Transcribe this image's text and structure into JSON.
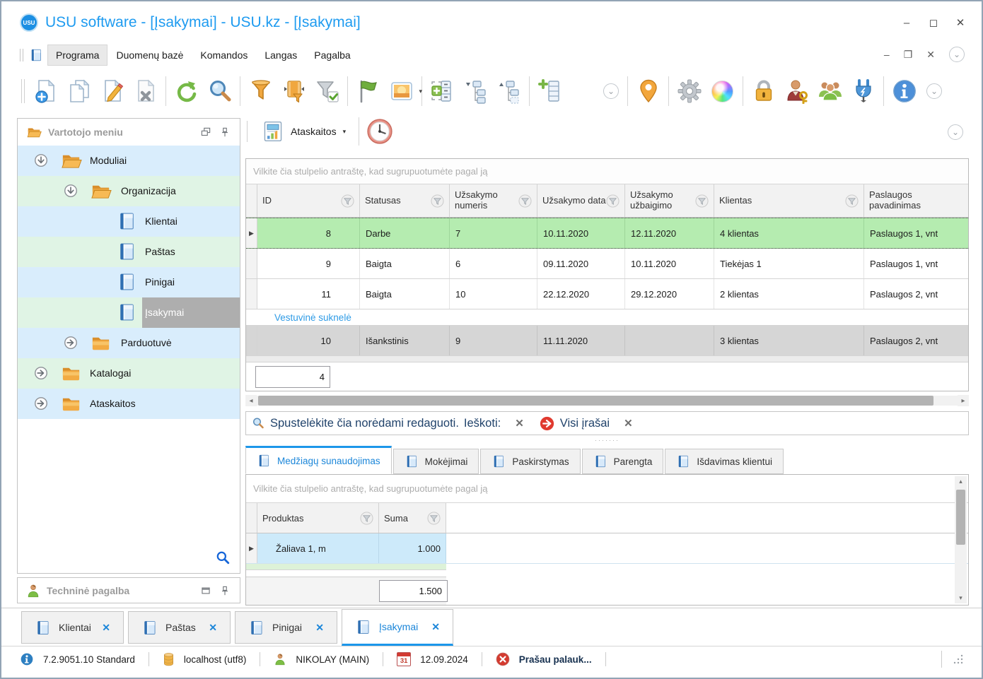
{
  "window": {
    "logo_text": "USU",
    "title": "USU software - [Įsakymai] - USU.kz - [Įsakymai]"
  },
  "menu": {
    "items": [
      "Programa",
      "Duomenų bazė",
      "Komandos",
      "Langas",
      "Pagalba"
    ]
  },
  "toolbar": {
    "buttons": [
      {
        "name": "new-record",
        "icon": "doc-new"
      },
      {
        "name": "copy-record",
        "icon": "doc-copy"
      },
      {
        "name": "edit-record",
        "icon": "doc-edit"
      },
      {
        "name": "delete-record",
        "icon": "doc-delete"
      },
      {
        "name": "refresh",
        "icon": "refresh"
      },
      {
        "name": "search",
        "icon": "search"
      },
      {
        "name": "filter",
        "icon": "funnel"
      },
      {
        "name": "filter-editor",
        "icon": "funnel-panel"
      },
      {
        "name": "apply-filter",
        "icon": "funnel-check"
      },
      {
        "name": "flag",
        "icon": "flag"
      },
      {
        "name": "image",
        "icon": "image"
      },
      {
        "name": "expand-all",
        "icon": "expand-all"
      },
      {
        "name": "expand-tree",
        "icon": "tree-down"
      },
      {
        "name": "collapse-tree",
        "icon": "tree-up"
      },
      {
        "name": "add-column",
        "icon": "add-row"
      },
      {
        "name": "map-pin",
        "icon": "map-pin"
      },
      {
        "name": "settings",
        "icon": "gear"
      },
      {
        "name": "colors",
        "icon": "sphere"
      },
      {
        "name": "lock",
        "icon": "lock"
      },
      {
        "name": "user-rights",
        "icon": "user-key"
      },
      {
        "name": "users",
        "icon": "users"
      },
      {
        "name": "plugin",
        "icon": "plug"
      },
      {
        "name": "info",
        "icon": "info"
      }
    ]
  },
  "sidebar": {
    "user_menu_title": "Vartotojo meniu",
    "support_title": "Techninė pagalba",
    "tree": [
      {
        "label": "Moduliai",
        "type": "folder",
        "level": 0,
        "state": "expanded"
      },
      {
        "label": "Organizacija",
        "type": "folder",
        "level": 1,
        "state": "expanded"
      },
      {
        "label": "Klientai",
        "type": "module",
        "level": 2
      },
      {
        "label": "Paštas",
        "type": "module",
        "level": 2
      },
      {
        "label": "Pinigai",
        "type": "module",
        "level": 2
      },
      {
        "label": "Įsakymai",
        "type": "module",
        "level": 2,
        "selected": true
      },
      {
        "label": "Parduotuvė",
        "type": "folder",
        "level": 1,
        "state": "collapsed"
      },
      {
        "label": "Katalogai",
        "type": "folder",
        "level": 0,
        "state": "collapsed"
      },
      {
        "label": "Ataskaitos",
        "type": "folder",
        "level": 0,
        "state": "collapsed"
      }
    ]
  },
  "report_bar": {
    "reports_label": "Ataskaitos"
  },
  "main_grid": {
    "group_hint": "Vilkite čia stulpelio antraštę, kad sugrupuotumėte pagal ją",
    "columns": [
      "ID",
      "Statusas",
      "Užsakymo numeris",
      "Užsakymo data",
      "Užsakymo užbaigimo",
      "Klientas",
      "Paslaugos pavadinimas"
    ],
    "rows": [
      {
        "cells": [
          "8",
          "Darbe",
          "7",
          "10.11.2020",
          "12.11.2020",
          "4 klientas",
          "Paslaugos 1, vnt"
        ],
        "selected": true
      },
      {
        "cells": [
          "9",
          "Baigta",
          "6",
          "09.11.2020",
          "10.11.2020",
          "Tiekėjas 1",
          "Paslaugos 1, vnt"
        ]
      },
      {
        "cells": [
          "11",
          "Baigta",
          "10",
          "22.12.2020",
          "29.12.2020",
          "2 klientas",
          "Paslaugos 2, vnt"
        ]
      },
      {
        "cells": [
          "10",
          "Išankstinis",
          "9",
          "11.11.2020",
          "",
          "3 klientas",
          "Paslaugos 2, vnt"
        ],
        "gray": true
      }
    ],
    "group_row": "Vestuvinė suknelė",
    "count": "4"
  },
  "filter_bar": {
    "edit_hint": "Spustelėkite čia norėdami redaguoti.",
    "search_label": "Ieškoti:",
    "all_records": "Visi įrašai"
  },
  "detail_tabs": [
    {
      "label": "Medžiagų sunaudojimas",
      "active": true
    },
    {
      "label": "Mokėjimai"
    },
    {
      "label": "Paskirstymas"
    },
    {
      "label": "Parengta"
    },
    {
      "label": "Išdavimas klientui"
    }
  ],
  "detail_grid": {
    "group_hint": "Vilkite čia stulpelio antraštę, kad sugrupuotumėte pagal ją",
    "columns": [
      "Produktas",
      "Suma"
    ],
    "rows": [
      {
        "produktas": "Žaliava 1, m",
        "suma": "1.000"
      }
    ],
    "total": "1.500"
  },
  "bottom_tabs": [
    {
      "label": "Klientai"
    },
    {
      "label": "Paštas"
    },
    {
      "label": "Pinigai"
    },
    {
      "label": "Įsakymai",
      "active": true
    }
  ],
  "status_bar": {
    "version": "7.2.9051.10 Standard",
    "database": "localhost (utf8)",
    "user": "NIKOLAY (MAIN)",
    "calendar_day": "31",
    "date": "12.09.2024",
    "message": "Prašau palauk..."
  },
  "colors": {
    "accent_blue": "#1c97ea",
    "title_blue": "#1e9bf0",
    "selected_row_green": "#b5ecb0",
    "tree_row_blue": "#d9edfc",
    "tree_row_green": "#e0f4e5",
    "selected_gray": "#aeaeae",
    "detail_selected_blue": "#cdeafa"
  }
}
